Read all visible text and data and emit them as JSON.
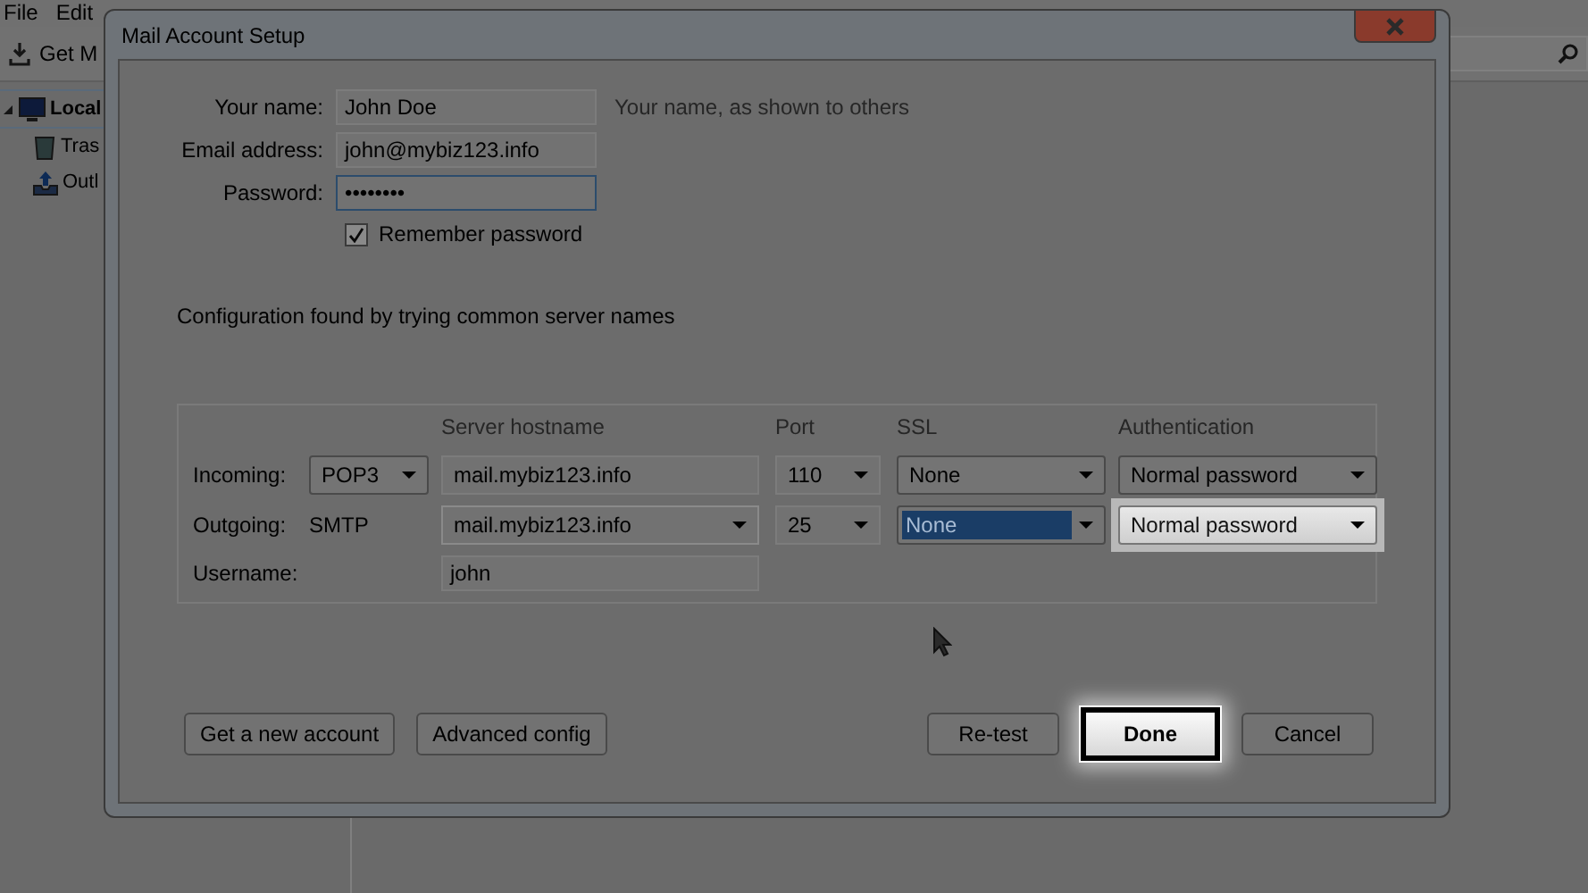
{
  "app": {
    "menu": [
      "File",
      "Edit"
    ],
    "toolbar_button": "Get M",
    "folders": [
      {
        "label": "Local",
        "expanded": true,
        "children": [
          {
            "label": "Tras",
            "kind": "trash"
          },
          {
            "label": "Outl",
            "kind": "outbox"
          }
        ]
      }
    ]
  },
  "dialog": {
    "title": "Mail Account Setup",
    "fields": [
      {
        "label": "Your name:",
        "value": "John Doe",
        "hint": "Your name, as shown to others",
        "focused": false
      },
      {
        "label": "Email address:",
        "value": "john@mybiz123.info",
        "focused": false
      },
      {
        "label": "Password:",
        "value": "••••••••",
        "focused": true
      }
    ],
    "remember": {
      "label": "Remember password",
      "checked": true
    },
    "status": "Configuration found by trying common server names",
    "servers": {
      "headers": [
        "Server hostname",
        "Port",
        "SSL",
        "Authentication"
      ],
      "rows": [
        {
          "label": "Incoming:",
          "protocol": {
            "kind": "select",
            "value": "POP3"
          },
          "hostname": {
            "value": "mail.mybiz123.info",
            "dropdown": false
          },
          "port": "110",
          "ssl": {
            "value": "None",
            "focused": false
          },
          "auth": {
            "value": "Normal password",
            "highlighted": false
          }
        },
        {
          "label": "Outgoing:",
          "protocol": {
            "kind": "text",
            "value": "SMTP"
          },
          "hostname": {
            "value": "mail.mybiz123.info",
            "dropdown": true
          },
          "port": "25",
          "ssl": {
            "value": "None",
            "focused": true
          },
          "auth": {
            "value": "Normal password",
            "highlighted": true
          }
        }
      ],
      "username": {
        "label": "Username:",
        "value": "john"
      }
    },
    "buttons_left": [
      {
        "label": "Get a new account",
        "highlighted": false
      },
      {
        "label": "Advanced config",
        "highlighted": false
      }
    ],
    "buttons_right": [
      {
        "label": "Re-test",
        "highlighted": false
      },
      {
        "label": "Done",
        "highlighted": true
      },
      {
        "label": "Cancel",
        "highlighted": false
      }
    ]
  }
}
